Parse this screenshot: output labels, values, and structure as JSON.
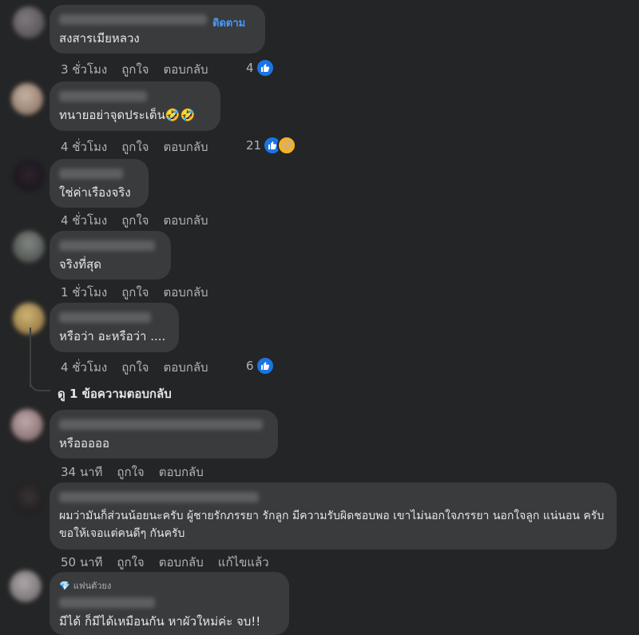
{
  "comments": [
    {
      "text": "สงสารเมียหลวง",
      "follow": "ติดตาม",
      "time": "3 ชั่วโมง",
      "like": "ถูกใจ",
      "reply": "ตอบกลับ",
      "reaction_count": "4"
    },
    {
      "text": "ทนายอย่าจุดประเด็น🤣🤣",
      "time": "4 ชั่วโมง",
      "like": "ถูกใจ",
      "reply": "ตอบกลับ",
      "reaction_count": "21"
    },
    {
      "text": "ใช่ค่าเรืองจริง",
      "time": "4 ชั่วโมง",
      "like": "ถูกใจ",
      "reply": "ตอบกลับ"
    },
    {
      "text": "จริงที่สุด",
      "time": "1 ชั่วโมง",
      "like": "ถูกใจ",
      "reply": "ตอบกลับ"
    },
    {
      "text": "หรือว่า อะหรือว่า ....",
      "time": "4 ชั่วโมง",
      "like": "ถูกใจ",
      "reply": "ตอบกลับ",
      "reaction_count": "6"
    },
    {
      "text": "หรือออออ",
      "time": "34 นาที",
      "like": "ถูกใจ",
      "reply": "ตอบกลับ"
    },
    {
      "text": "ผมว่ามันก็ส่วนน้อยนะครับ ผู้ชายรักภรรยา รักลูก มีความรับผิดชอบพอ เขาไม่นอกใจภรรยา นอกใจลูก แน่นอน ครับ ขอให้เจอแต่คนดีๆ กันครับ",
      "time": "50 นาที",
      "like": "ถูกใจ",
      "reply": "ตอบกลับ",
      "edited": "แก้ไขแล้ว"
    },
    {
      "text": "มีได้ ก็มีได้เหมือนกัน หาผัวใหม่ค่ะ จบ!!",
      "badge": "แฟนตัวยง"
    }
  ],
  "view_replies": "ดู 1 ข้อความตอบกลับ",
  "icons": {
    "like": "like-icon",
    "haha": "haha-icon",
    "gem": "diamond-icon"
  },
  "colors": {
    "background": "#242526",
    "bubble": "#3a3b3c",
    "link": "#4599ff",
    "like_blue": "#1b74e4"
  }
}
